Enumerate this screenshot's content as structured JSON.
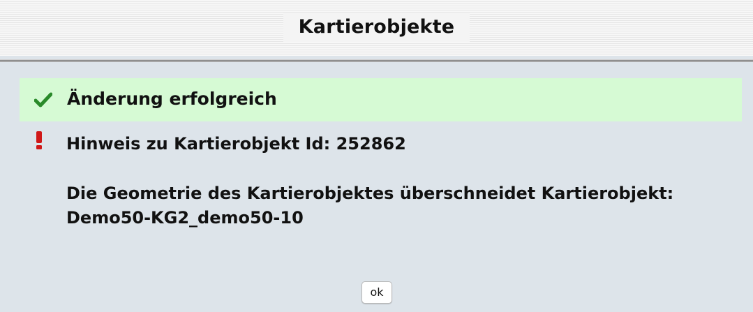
{
  "dialog": {
    "title": "Kartierobjekte"
  },
  "success": {
    "icon": "check-icon",
    "color": "#2a8a2a",
    "background": "#d6fad4",
    "message": "Änderung erfolgreich"
  },
  "notice": {
    "icon": "exclamation-icon",
    "color": "#d01818",
    "heading": "Hinweis zu Kartierobjekt Id: 252862",
    "body_line1": "Die Geometrie des Kartierobjektes überschneidet Kartierobjekt:",
    "body_line2": "Demo50-KG2_demo50-10"
  },
  "buttons": {
    "ok_label": "ok"
  }
}
